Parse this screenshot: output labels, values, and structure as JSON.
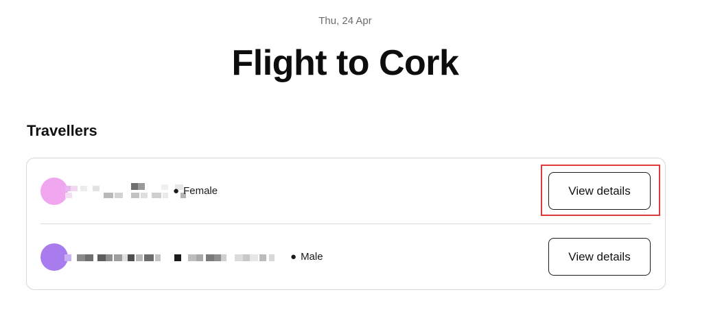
{
  "header": {
    "date": "Thu, 24 Apr",
    "title": "Flight to Cork"
  },
  "travellers": {
    "heading": "Travellers",
    "items": [
      {
        "gender": "Female",
        "button_label": "View details",
        "avatar_color": "#f0a7ef",
        "selected": true
      },
      {
        "gender": "Male",
        "button_label": "View details",
        "avatar_color": "#a97cee",
        "selected": false
      }
    ]
  },
  "colors": {
    "highlight": "#e0393a",
    "border": "#d6d6d6",
    "muted_text": "#6b6b6b"
  }
}
